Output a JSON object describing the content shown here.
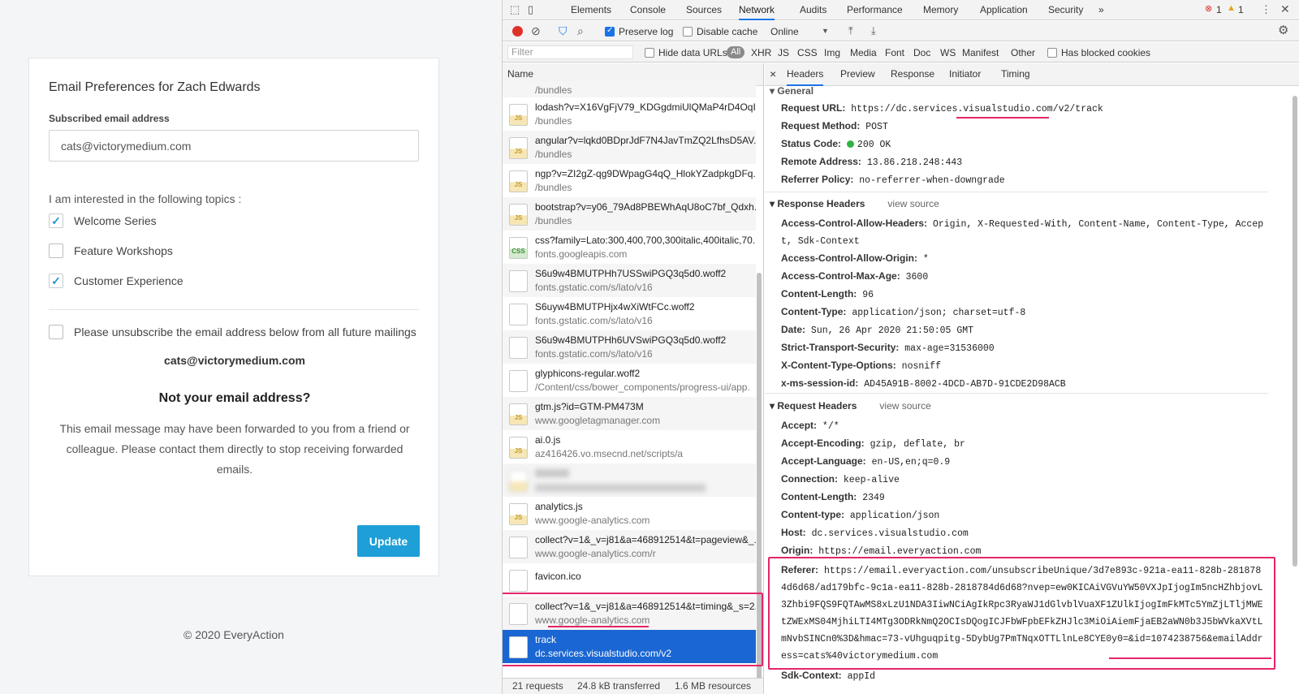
{
  "prefs": {
    "title": "Email Preferences for Zach Edwards",
    "subscribed_label": "Subscribed email address",
    "email_value": "cats@victorymedium.com",
    "topics_intro": "I am interested in the following topics :",
    "topics": [
      {
        "label": "Welcome Series",
        "checked": true
      },
      {
        "label": "Feature Workshops",
        "checked": false
      },
      {
        "label": "Customer Experience",
        "checked": true
      }
    ],
    "unsubscribe_label": "Please unsubscribe the email address below from all future mailings",
    "unsubscribe_email": "cats@victorymedium.com",
    "not_yours_heading": "Not your email address?",
    "forwarded_message": "This email message may have been forwarded to you from a friend or colleague. Please contact them directly to stop receiving forwarded emails.",
    "update_label": "Update",
    "copyright": "© 2020 EveryAction"
  },
  "devtools": {
    "tabs": [
      "Elements",
      "Console",
      "Sources",
      "Network",
      "Audits",
      "Performance",
      "Memory",
      "Application",
      "Security"
    ],
    "active_tab": "Network",
    "more_tabs": "»",
    "error_count": "1",
    "warning_count": "1",
    "toolbar": {
      "preserve_log": "Preserve log",
      "disable_cache": "Disable cache",
      "throttle": "Online"
    },
    "filterbar": {
      "filter_placeholder": "Filter",
      "hide_data_urls": "Hide data URLs",
      "types": [
        "All",
        "XHR",
        "JS",
        "CSS",
        "Img",
        "Media",
        "Font",
        "Doc",
        "WS",
        "Manifest",
        "Other"
      ],
      "has_blocked_cookies": "Has blocked cookies"
    },
    "list": {
      "header": "Name",
      "partial_top": "/bundles",
      "rows": [
        {
          "name": "lodash?v=X16VgFjV79_KDGgdmiUlQMaP4rD4OqI.",
          "domain": "/bundles",
          "icon": "JS"
        },
        {
          "name": "angular?v=lqkd0BDprJdF7N4JavTmZQ2LfhsD5AV.",
          "domain": "/bundles",
          "icon": "JS"
        },
        {
          "name": "ngp?v=ZI2gZ-qg9DWpagG4qQ_HlokYZadpkgDFq.",
          "domain": "/bundles",
          "icon": "JS"
        },
        {
          "name": "bootstrap?v=y06_79Ad8PBEWhAqU8oC7bf_Qdxh.",
          "domain": "/bundles",
          "icon": "JS"
        },
        {
          "name": "css?family=Lato:300,400,700,300italic,400italic,70.",
          "domain": "fonts.googleapis.com",
          "icon": "CSS"
        },
        {
          "name": "S6u9w4BMUTPHh7USSwiPGQ3q5d0.woff2",
          "domain": "fonts.gstatic.com/s/lato/v16",
          "icon": ""
        },
        {
          "name": "S6uyw4BMUTPHjx4wXiWtFCc.woff2",
          "domain": "fonts.gstatic.com/s/lato/v16",
          "icon": ""
        },
        {
          "name": "S6u9w4BMUTPHh6UVSwiPGQ3q5d0.woff2",
          "domain": "fonts.gstatic.com/s/lato/v16",
          "icon": ""
        },
        {
          "name": "glyphicons-regular.woff2",
          "domain": "/Content/css/bower_components/progress-ui/app.",
          "icon": ""
        },
        {
          "name": "gtm.js?id=GTM-PM473M",
          "domain": "www.googletagmanager.com",
          "icon": "JS"
        },
        {
          "name": "ai.0.js",
          "domain": "az416426.vo.msecnd.net/scripts/a",
          "icon": "JS"
        },
        {
          "name": "",
          "domain": "",
          "icon": ""
        },
        {
          "name": "analytics.js",
          "domain": "www.google-analytics.com",
          "icon": "JS"
        },
        {
          "name": "collect?v=1&_v=j81&a=468912514&t=pageview&_.",
          "domain": "www.google-analytics.com/r",
          "icon": ""
        },
        {
          "name": "favicon.ico",
          "domain": "",
          "icon": ""
        },
        {
          "name": "collect?v=1&_v=j81&a=468912514&t=timing&_s=2.",
          "domain": "www.google-analytics.com",
          "icon": ""
        },
        {
          "name": "track",
          "domain": "dc.services.visualstudio.com/v2",
          "icon": ""
        }
      ],
      "status": {
        "requests": "21 requests",
        "transferred": "24.8 kB transferred",
        "resources": "1.6 MB resources"
      }
    },
    "detail": {
      "close": "×",
      "tabs": [
        "Headers",
        "Preview",
        "Response",
        "Initiator",
        "Timing"
      ],
      "active_tab": "Headers",
      "general_title": "General",
      "general": [
        {
          "k": "Request URL:",
          "v": "https://dc.services.visualstudio.com/v2/track"
        },
        {
          "k": "Request Method:",
          "v": "POST"
        },
        {
          "k": "Status Code:",
          "v": "200 OK"
        },
        {
          "k": "Remote Address:",
          "v": "13.86.218.248:443"
        },
        {
          "k": "Referrer Policy:",
          "v": "no-referrer-when-downgrade"
        }
      ],
      "response_title": "Response Headers",
      "view_source": "view source",
      "response": [
        {
          "k": "Access-Control-Allow-Headers:",
          "v": "Origin, X-Requested-With, Content-Name, Content-Type, Accept, Sdk-Context"
        },
        {
          "k": "Access-Control-Allow-Origin:",
          "v": "*"
        },
        {
          "k": "Access-Control-Max-Age:",
          "v": "3600"
        },
        {
          "k": "Content-Length:",
          "v": "96"
        },
        {
          "k": "Content-Type:",
          "v": "application/json; charset=utf-8"
        },
        {
          "k": "Date:",
          "v": "Sun, 26 Apr 2020 21:50:05 GMT"
        },
        {
          "k": "Strict-Transport-Security:",
          "v": "max-age=31536000"
        },
        {
          "k": "X-Content-Type-Options:",
          "v": "nosniff"
        },
        {
          "k": "x-ms-session-id:",
          "v": "AD45A91B-8002-4DCD-AB7D-91CDE2D98ACB"
        }
      ],
      "request_title": "Request Headers",
      "request": [
        {
          "k": "Accept:",
          "v": "*/*"
        },
        {
          "k": "Accept-Encoding:",
          "v": "gzip, deflate, br"
        },
        {
          "k": "Accept-Language:",
          "v": "en-US,en;q=0.9"
        },
        {
          "k": "Connection:",
          "v": "keep-alive"
        },
        {
          "k": "Content-Length:",
          "v": "2349"
        },
        {
          "k": "Content-type:",
          "v": "application/json"
        },
        {
          "k": "Host:",
          "v": "dc.services.visualstudio.com"
        },
        {
          "k": "Origin:",
          "v": "https://email.everyaction.com"
        }
      ],
      "referer_key": "Referer:",
      "referer_value": "https://email.everyaction.com/unsubscribeUnique/3d7e893c-921a-ea11-828b-2818784d6d68/ad179bfc-9c1a-ea11-828b-2818784d6d68?nvep=ew0KICAiVGVuYW50VXJpIjogIm5ncHZhbjovL3Zhbi9FQS9FQTAwMS8xLzU1NDA3IiwNCiAgIkRpc3RyaWJ1dGlvblVuaXF1ZUlkIjogImFkMTc5YmZjLTljMWEtZWExMS04MjhiLTI4MTg3ODRkNmQ2OCIsDQogICJFbWFpbEFkZHJlc3MiOiAiemFjaEB2aWN0b3J5bWVkaXVtLmNvbSINCn0%3D&hmac=73-vUhguqpitg-5DybUg7PmTNqxOTTLlnLe8CYE0y0=&id=1074238756&emailAddress=cats%40victorymedium.com",
      "sdk_key": "Sdk-Context:",
      "sdk_value": "appId"
    }
  }
}
